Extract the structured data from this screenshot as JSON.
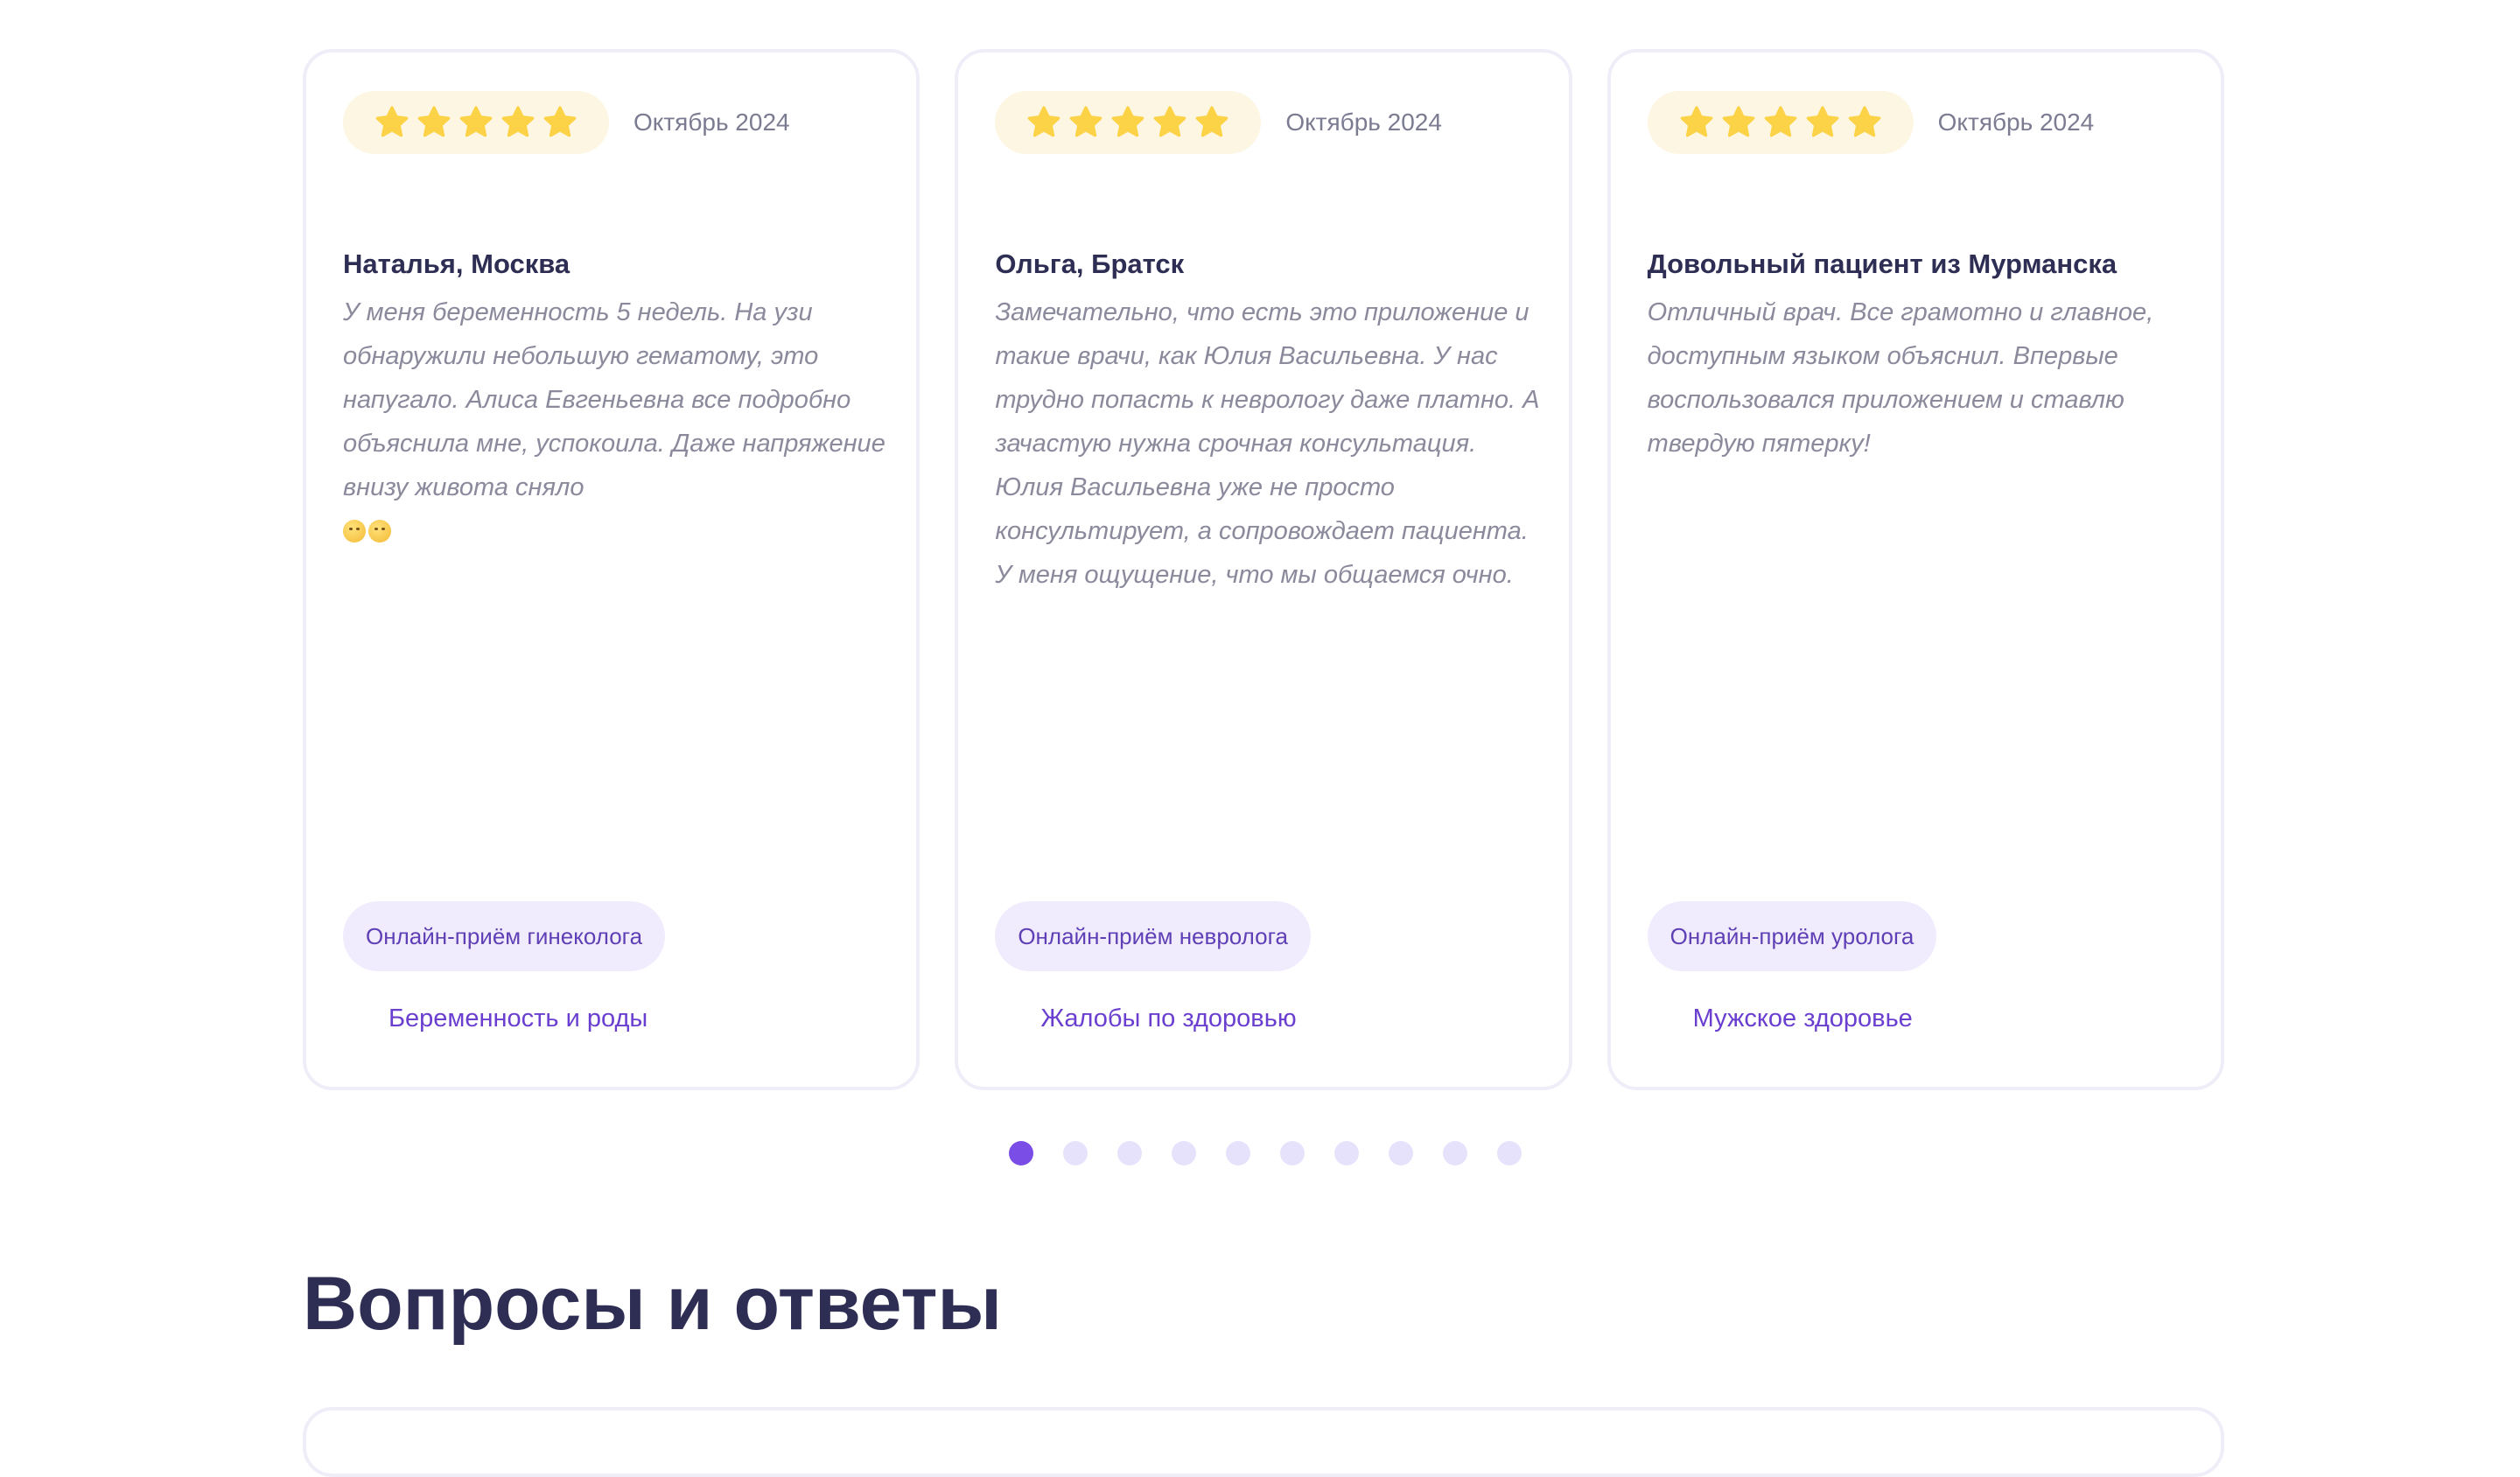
{
  "reviews": [
    {
      "rating": 5,
      "date": "Октябрь 2024",
      "author": "Наталья, Москва",
      "text": "У меня беременность 5 недель. На узи обнаружили небольшую гематому, это напугало. Алиса Евгеньевна все подробно объяснила мне, успокоила. Даже напряжение внизу живота сняло",
      "emoji": [
        "relieved-face-emoji",
        "grinning-sweat-face-emoji"
      ],
      "service": "Онлайн-приём гинеколога",
      "topic": "Беременность и роды"
    },
    {
      "rating": 5,
      "date": "Октябрь 2024",
      "author": "Ольга, Братск",
      "text": "Замечательно, что есть это приложение и такие врачи, как Юлия Васильевна. У нас трудно попасть к неврологу даже платно. А зачастую нужна срочная консультация. Юлия Васильевна уже не просто консультирует, а сопровождает пациента. У меня ощущение, что мы общаемся очно.",
      "service": "Онлайн-приём невролога",
      "topic": "Жалобы по здоровью"
    },
    {
      "rating": 5,
      "date": "Октябрь 2024",
      "author": "Довольный пациент из Мурманска",
      "text": "Отличный врач. Все грамотно и главное, доступным языком объяснил. Впервые воспользовался приложением и ставлю твердую пятерку!",
      "service": "Онлайн-приём уролога",
      "topic": "Мужское здоровье"
    }
  ],
  "pagination": {
    "total": 10,
    "active": 1
  },
  "faq": {
    "title": "Вопросы и ответы"
  },
  "colors": {
    "accent": "#7a4de6",
    "star": "#fcd347",
    "heading": "#2e2e54",
    "muted": "#8a8a9c"
  }
}
